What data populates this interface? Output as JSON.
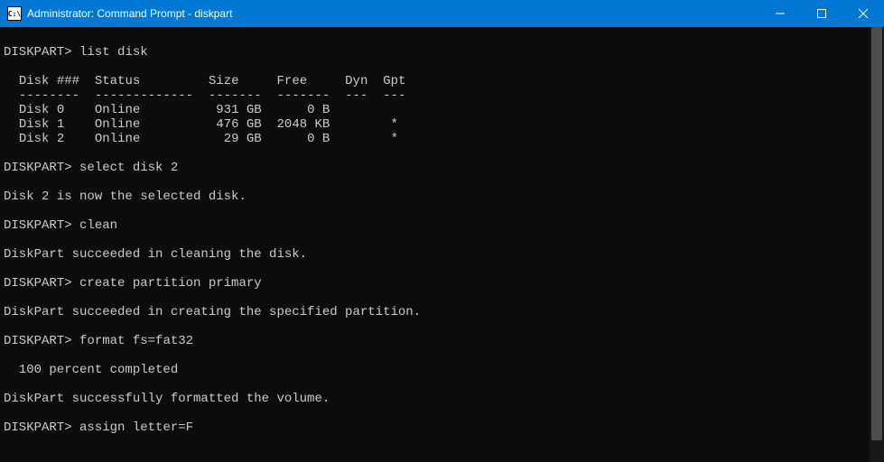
{
  "titlebar": {
    "icon_text": "C:\\",
    "title": "Administrator: Command Prompt - diskpart"
  },
  "prompt": "DISKPART>",
  "commands": {
    "list_disk": "list disk",
    "select_disk": "select disk 2",
    "clean": "clean",
    "create_partition": "create partition primary",
    "format": "format fs=fat32",
    "assign": "assign letter=F"
  },
  "table": {
    "hdr_disk": "Disk ###",
    "hdr_status": "Status",
    "hdr_size": "Size",
    "hdr_free": "Free",
    "hdr_dyn": "Dyn",
    "hdr_gpt": "Gpt",
    "sep_disk": "--------",
    "sep_status": "-------------",
    "sep_size": "-------",
    "sep_free": "-------",
    "sep_dyn": "---",
    "sep_gpt": "---",
    "rows": [
      {
        "disk": "Disk 0",
        "status": "Online",
        "size": "931 GB",
        "free": "0 B",
        "dyn": "",
        "gpt": ""
      },
      {
        "disk": "Disk 1",
        "status": "Online",
        "size": "476 GB",
        "free": "2048 KB",
        "dyn": "",
        "gpt": "*"
      },
      {
        "disk": "Disk 2",
        "status": "Online",
        "size": "29 GB",
        "free": "0 B",
        "dyn": "",
        "gpt": "*"
      }
    ]
  },
  "messages": {
    "selected": "Disk 2 is now the selected disk.",
    "clean_ok": "DiskPart succeeded in cleaning the disk.",
    "partition_ok": "DiskPart succeeded in creating the specified partition.",
    "percent": "  100 percent completed",
    "format_ok": "DiskPart successfully formatted the volume."
  }
}
